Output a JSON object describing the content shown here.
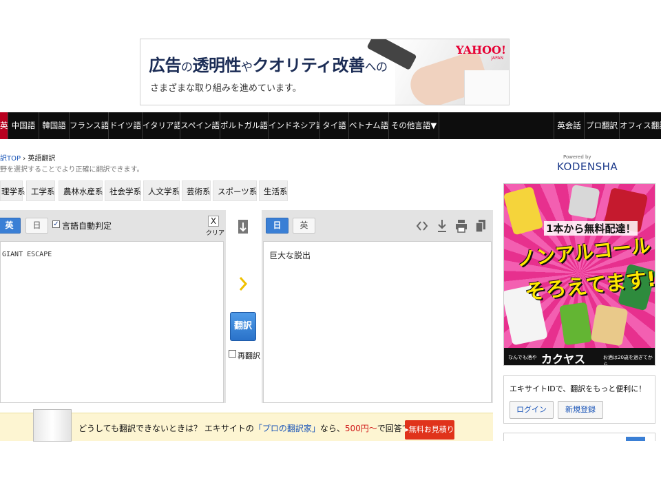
{
  "banner": {
    "headline_a": "広告",
    "headline_b": "の",
    "headline_c": "透明性",
    "headline_d": "や",
    "headline_e": "クオリティ改善",
    "headline_f": "への",
    "subtext": "さまざまな取り組みを進めています。",
    "brand": "YAHOO!",
    "brand_sub": "JAPAN"
  },
  "nav": {
    "items": [
      {
        "label": "英"
      },
      {
        "label": "中国語"
      },
      {
        "label": "韓国語"
      },
      {
        "label": "フランス語"
      },
      {
        "label": "ドイツ語"
      },
      {
        "label": "イタリア語"
      },
      {
        "label": "スペイン語"
      },
      {
        "label": "ポルトガル語"
      },
      {
        "label": "インドネシア語"
      },
      {
        "label": "タイ語"
      },
      {
        "label": "ベトナム語"
      },
      {
        "label": "その他言語▼"
      },
      {
        "label": "英会話"
      },
      {
        "label": "プロ翻訳"
      },
      {
        "label": "オフィス翻訳"
      }
    ]
  },
  "breadcrumb": {
    "home": "訳TOP",
    "separator": "›",
    "current": "英語翻訳",
    "hint": "野を選択することでより正確に翻訳できます。"
  },
  "fields": {
    "items": [
      {
        "label": "理学系"
      },
      {
        "label": "工学系"
      },
      {
        "label": "農林水産系"
      },
      {
        "label": "社会学系"
      },
      {
        "label": "人文学系"
      },
      {
        "label": "芸術系"
      },
      {
        "label": "スポーツ系"
      },
      {
        "label": "生活系"
      }
    ]
  },
  "source": {
    "lang_active": "英",
    "lang_other": "日",
    "auto_detect_label": "言語自動判定",
    "auto_detect_checked": true,
    "clear_x": "X",
    "clear_label": "クリア",
    "text": "GIANT ESCAPE"
  },
  "middle": {
    "swap_icon": "⇅",
    "arrow": "›",
    "translate_label": "翻訳",
    "retranslate_label": "再翻訳"
  },
  "target": {
    "lang_active": "日",
    "lang_other": "英",
    "text": "巨大な脱出",
    "icons": [
      "code-icon",
      "download-icon",
      "print-icon",
      "copy-icon"
    ]
  },
  "promo": {
    "text_a": "どうしても翻訳できないときは？ エキサイトの",
    "text_link": "「プロの翻訳家」",
    "text_b": "なら、",
    "text_price": "500円～",
    "text_c": "で回答できます。",
    "cta": "▸無料お見積り"
  },
  "sidebar": {
    "powered": "Powered by",
    "kodensha": "KODENSHA",
    "ad_line1": "1本から無料配達！",
    "ad_line2": "ノンアルコール",
    "ad_line3": "そろえてます!!",
    "ad_note_left": "なんでも酒や",
    "ad_brand": "カクヤス",
    "ad_note_right": "お酒は20歳を過ぎてから",
    "account_msg": "エキサイトIDで、翻訳をもっと便利に！",
    "login": "ログイン",
    "register": "新規登録"
  },
  "colors": {
    "nav_bg": "#0d0d0d",
    "nav_active": "#b8001f",
    "accent_blue": "#3a7fd5",
    "promo_bg": "#fdf5d2",
    "cta_red": "#e0331b",
    "ad_pink": "#ef3e9a"
  }
}
